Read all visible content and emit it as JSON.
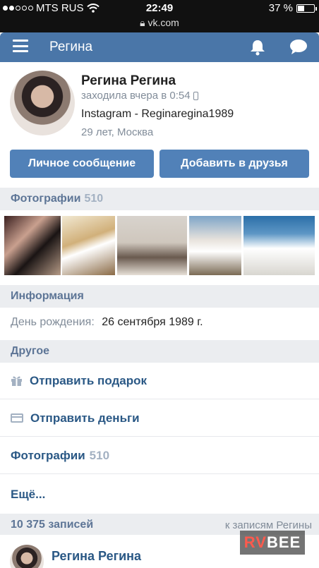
{
  "status_bar": {
    "carrier": "MTS RUS",
    "time": "22:49",
    "battery": "37 %",
    "battery_level": 0.37,
    "url": "vk.com"
  },
  "header": {
    "title": "Регина",
    "menu_icon": "hamburger-menu-icon",
    "notifications_icon": "bell-icon",
    "messages_icon": "chat-bubble-icon"
  },
  "profile": {
    "name": "Регина Регина",
    "last_seen": "заходила вчера в 0:54",
    "status": "Instagram - Reginaregina1989",
    "age_city": "29 лет, Москва",
    "message_button": "Личное сообщение",
    "add_friend_button": "Добавить в друзья"
  },
  "photos_section": {
    "title": "Фотографии",
    "count": "510"
  },
  "info_section": {
    "title": "Информация",
    "birthday_label": "День рождения:",
    "birthday_value": "26 сентября 1989 г."
  },
  "other_section": {
    "title": "Другое",
    "items": [
      {
        "label": "Отправить подарок",
        "icon": "gift-icon"
      },
      {
        "label": "Отправить деньги",
        "icon": "card-icon"
      }
    ],
    "photos_label": "Фотографии",
    "photos_count": "510",
    "more_label": "Ещё..."
  },
  "posts": {
    "count_label": "10 375 записей",
    "link_label": "к записям Регины",
    "first_author": "Регина Регина"
  },
  "colors": {
    "vk_blue": "#4a76a8",
    "button_blue": "#5181b8",
    "link_blue": "#2a5885",
    "section_bg": "#ebedf0"
  },
  "watermark": {
    "part1": "RV",
    "part2": "BEE"
  }
}
